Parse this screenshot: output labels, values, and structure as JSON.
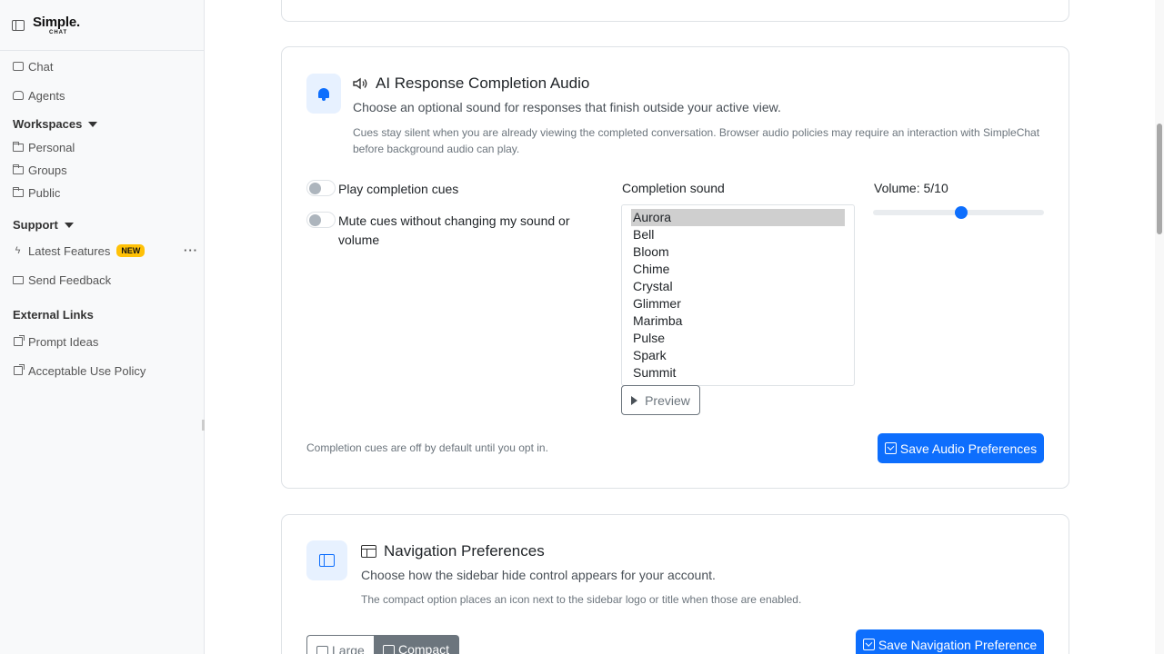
{
  "brand": {
    "name": "Simple.",
    "sub": "CHAT"
  },
  "sidebar": {
    "chat": "Chat",
    "agents": "Agents",
    "workspaces": {
      "heading": "Workspaces",
      "items": [
        "Personal",
        "Groups",
        "Public"
      ]
    },
    "support": {
      "heading": "Support",
      "latest_features": "Latest Features",
      "new_badge": "NEW",
      "feedback": "Send Feedback"
    },
    "external": {
      "heading": "External Links",
      "items": [
        "Prompt Ideas",
        "Acceptable Use Policy"
      ]
    }
  },
  "audio": {
    "title": "AI Response Completion Audio",
    "subtitle": "Choose an optional sound for responses that finish outside your active view.",
    "note": "Cues stay silent when you are already viewing the completed conversation. Browser audio policies may require an interaction with SimpleChat before background audio can play.",
    "toggle_play": "Play completion cues",
    "toggle_mute": "Mute cues without changing my sound or volume",
    "sound_label": "Completion sound",
    "sounds": [
      "Aurora",
      "Bell",
      "Bloom",
      "Chime",
      "Crystal",
      "Glimmer",
      "Marimba",
      "Pulse",
      "Spark",
      "Summit"
    ],
    "selected_sound": "Aurora",
    "preview_label": "Preview",
    "volume_label": "Volume: 5/10",
    "volume_value": 5,
    "volume_max": 10,
    "footer_note": "Completion cues are off by default until you opt in.",
    "save_label": "Save Audio Preferences"
  },
  "navigation": {
    "title": "Navigation Preferences",
    "subtitle": "Choose how the sidebar hide control appears for your account.",
    "note": "The compact option places an icon next to the sidebar logo or title when those are enabled.",
    "option_large": "Large",
    "option_compact": "Compact",
    "selected_option": "Compact",
    "save_label": "Save Navigation Preference"
  },
  "colors": {
    "primary": "#0d6efd",
    "secondary": "#6c757d",
    "badge": "#ffc107",
    "icon_tile": "#e7f1ff"
  }
}
